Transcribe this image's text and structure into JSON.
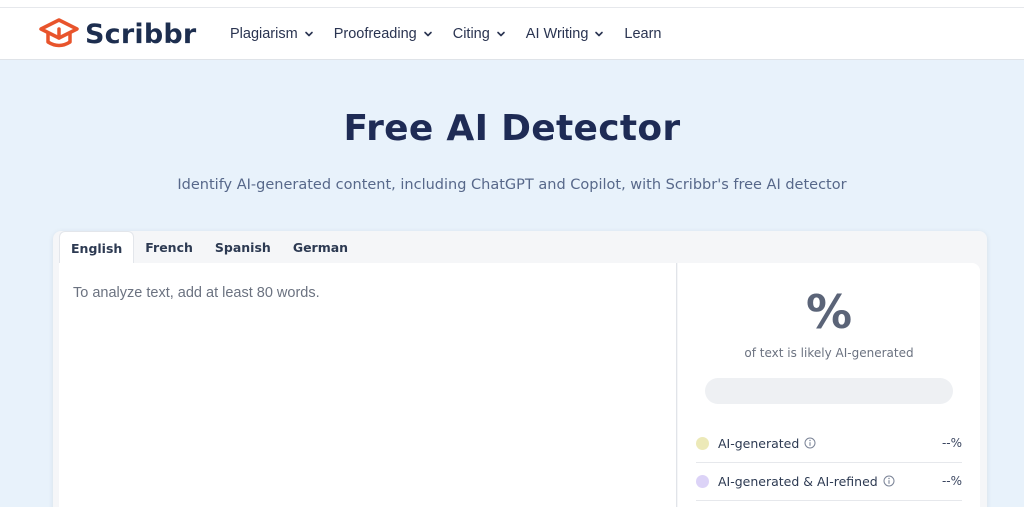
{
  "header": {
    "logo_text": "Scribbr",
    "nav": [
      {
        "label": "Plagiarism",
        "has_dropdown": true
      },
      {
        "label": "Proofreading",
        "has_dropdown": true
      },
      {
        "label": "Citing",
        "has_dropdown": true
      },
      {
        "label": "AI Writing",
        "has_dropdown": true
      },
      {
        "label": "Learn",
        "has_dropdown": false
      }
    ]
  },
  "hero": {
    "title": "Free AI Detector",
    "subtitle": "Identify AI-generated content, including ChatGPT and Copilot, with Scribbr's free AI detector"
  },
  "detector": {
    "tabs": [
      {
        "label": "English",
        "active": true
      },
      {
        "label": "French",
        "active": false
      },
      {
        "label": "Spanish",
        "active": false
      },
      {
        "label": "German",
        "active": false
      }
    ],
    "placeholder": "To analyze text, add at least 80 words.",
    "result": {
      "percent": "%",
      "percent_label": "of text is likely AI-generated",
      "rows": [
        {
          "label": "AI-generated",
          "value": "--%",
          "color": "#ece9b8"
        },
        {
          "label": "AI-generated & AI-refined",
          "value": "--%",
          "color": "#dcd3f7"
        }
      ]
    }
  },
  "colors": {
    "brand_orange": "#e8542c",
    "brand_navy": "#1d2e4f",
    "page_bg": "#e8f2fb"
  }
}
